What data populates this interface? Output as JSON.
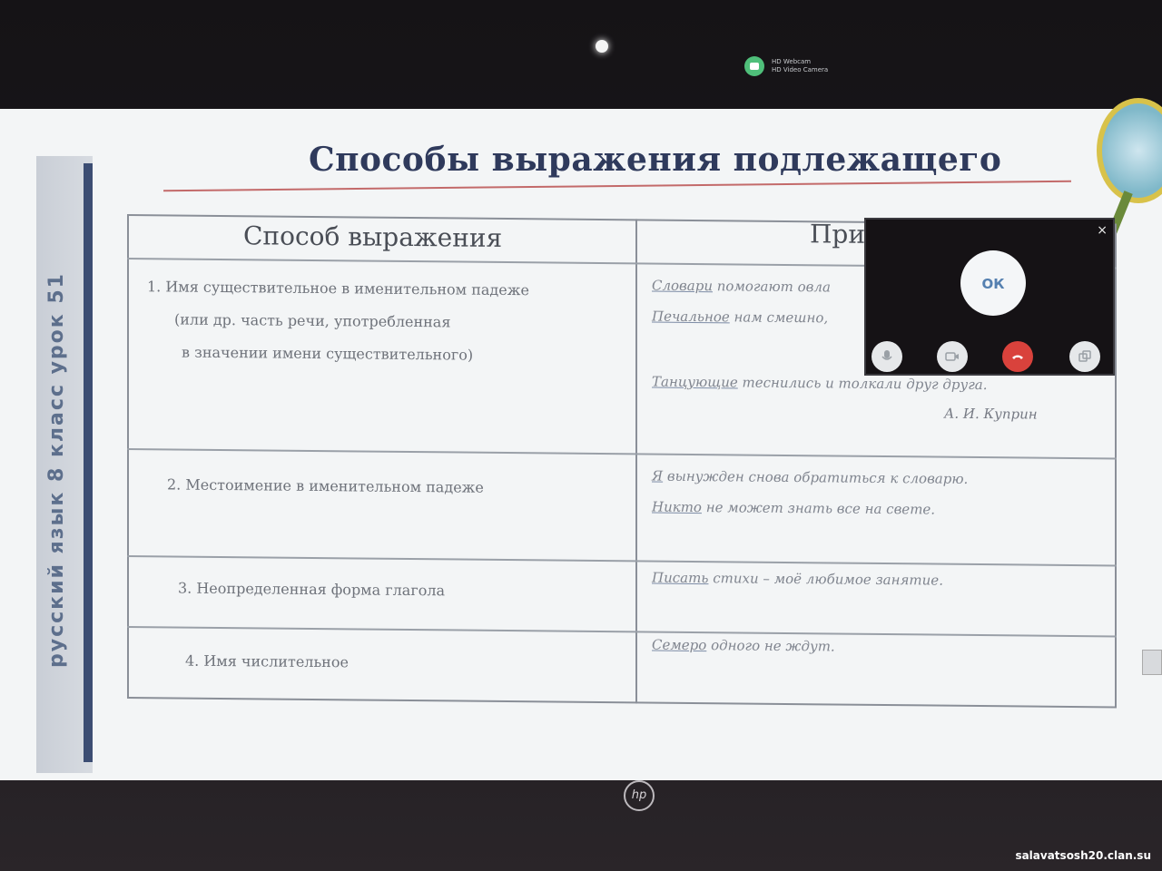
{
  "webcam_notice": {
    "line1": "HD Webcam",
    "line2": "HD Video Camera"
  },
  "slide": {
    "title": "Способы выражения подлежащего",
    "side_label": "русский язык  8 класс  урок 51",
    "table": {
      "header_left": "Способ  выражения",
      "header_right": "При",
      "rows": [
        {
          "left": [
            "1. Имя существительное в именительном падеже",
            "(или др. часть речи, употребленная",
            "в значении имени существительного)"
          ],
          "right": [
            {
              "u": "Словари",
              "rest": " помогают овла"
            },
            {
              "u": "Печальное",
              "rest": " нам смешно, "
            },
            {
              "u": "Танцующие",
              "rest": " теснились и толкали друг друга."
            }
          ],
          "author": "А. И. Куприн"
        },
        {
          "left": [
            "2. Местоимение в именительном падеже"
          ],
          "right": [
            {
              "u": "Я",
              "rest": " вынужден снова обратиться к словарю."
            },
            {
              "u": "Никто",
              "rest": " не может знать все на свете."
            }
          ]
        },
        {
          "left": [
            "3. Неопределенная форма глагола"
          ],
          "right": [
            {
              "u": "Писать",
              "rest": " стихи – моё любимое занятие."
            }
          ]
        },
        {
          "left": [
            "4. Имя числительное"
          ],
          "right": [
            {
              "u": "Семеро",
              "rest": " одного не ждут."
            }
          ]
        }
      ]
    }
  },
  "call_popup": {
    "close": "×",
    "ok_label": "ОК",
    "buttons": [
      "microphone-icon",
      "camera-icon",
      "hang-up-icon",
      "screen-share-icon"
    ],
    "hang_color": "#d9423c"
  },
  "brand": "hp",
  "watermark": "salavatsosh20.clan.su"
}
